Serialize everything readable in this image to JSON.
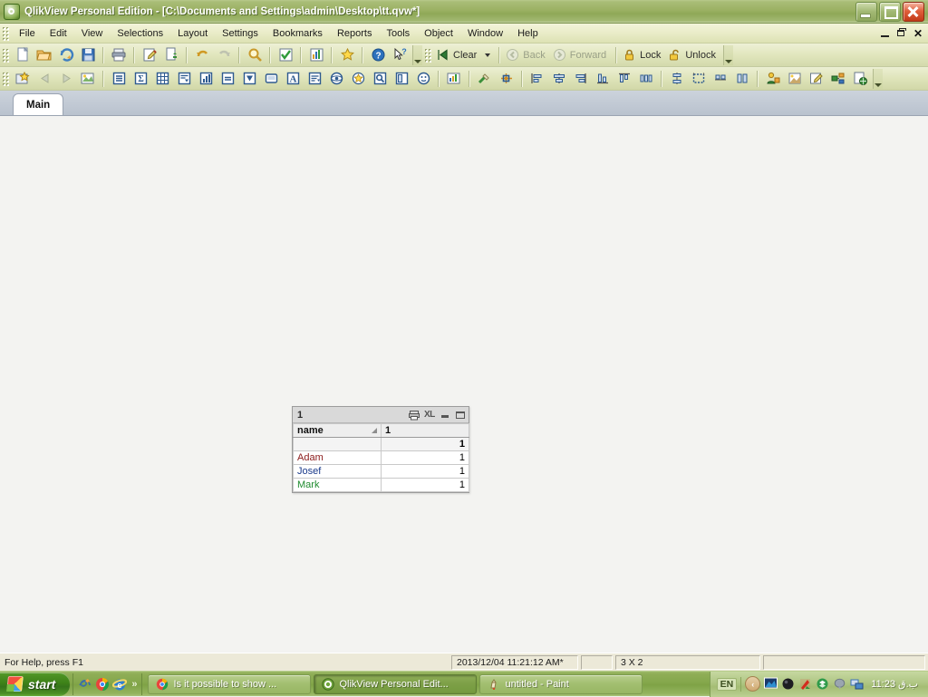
{
  "window": {
    "title": "QlikView Personal Edition - [C:\\Documents and Settings\\admin\\Desktop\\tt.qvw*]",
    "app_icon": "qlikview-icon",
    "controls": {
      "minimize": "Minimize",
      "restore": "Restore",
      "close": "Close"
    },
    "mdi_controls": {
      "minimize": "Minimize Document",
      "restore": "Restore Document",
      "close": "Close Document",
      "close_glyph": "✕"
    }
  },
  "menubar": {
    "items": [
      {
        "label": "File"
      },
      {
        "label": "Edit"
      },
      {
        "label": "View"
      },
      {
        "label": "Selections"
      },
      {
        "label": "Layout"
      },
      {
        "label": "Settings"
      },
      {
        "label": "Bookmarks"
      },
      {
        "label": "Reports"
      },
      {
        "label": "Tools"
      },
      {
        "label": "Object"
      },
      {
        "label": "Window"
      },
      {
        "label": "Help"
      }
    ]
  },
  "standard_toolbar": {
    "buttons": [
      {
        "name": "new-document-icon"
      },
      {
        "name": "open-document-icon"
      },
      {
        "name": "reload-icon"
      },
      {
        "name": "save-icon"
      },
      {
        "name": "print-icon"
      },
      {
        "name": "edit-script-icon"
      },
      {
        "name": "copy-image-icon"
      },
      {
        "name": "undo-icon"
      },
      {
        "name": "redo-icon"
      },
      {
        "name": "search-icon"
      },
      {
        "name": "current-selections-icon"
      },
      {
        "name": "chart-icon"
      },
      {
        "name": "add-bookmark-icon"
      },
      {
        "name": "help-icon"
      },
      {
        "name": "context-help-icon"
      }
    ]
  },
  "navigation_toolbar": {
    "clear_label": "Clear",
    "back_label": "Back",
    "forward_label": "Forward",
    "lock_label": "Lock",
    "unlock_label": "Unlock"
  },
  "design_toolbar": {
    "buttons": [
      {
        "name": "new-sheet-icon"
      },
      {
        "name": "previous-sheet-icon"
      },
      {
        "name": "next-sheet-icon"
      },
      {
        "name": "sheet-properties-icon"
      },
      {
        "name": "list-box-icon"
      },
      {
        "name": "statistics-box-icon"
      },
      {
        "name": "multi-box-icon"
      },
      {
        "name": "table-box-icon"
      },
      {
        "name": "chart-object-icon"
      },
      {
        "name": "input-box-icon"
      },
      {
        "name": "current-selections-box-icon"
      },
      {
        "name": "button-icon"
      },
      {
        "name": "text-object-icon"
      },
      {
        "name": "line-arrow-object-icon"
      },
      {
        "name": "slider-calendar-icon"
      },
      {
        "name": "bookmark-object-icon"
      },
      {
        "name": "search-object-icon"
      },
      {
        "name": "container-icon"
      },
      {
        "name": "custom-object-icon"
      },
      {
        "name": "system-table-icon"
      },
      {
        "name": "design-grid-icon"
      },
      {
        "name": "snap-to-grid-icon"
      },
      {
        "name": "align-left-icon"
      },
      {
        "name": "align-center-icon"
      },
      {
        "name": "align-right-icon"
      },
      {
        "name": "align-bottom-icon"
      },
      {
        "name": "align-top-icon"
      },
      {
        "name": "distribute-horizontal-icon"
      },
      {
        "name": "space-vertical-icon"
      },
      {
        "name": "size-equal-icon"
      },
      {
        "name": "space-across-icon"
      },
      {
        "name": "arrange-icon"
      },
      {
        "name": "promote-icon"
      },
      {
        "name": "layout-theme-icon"
      },
      {
        "name": "edit-module-icon"
      },
      {
        "name": "object-grouping-icon"
      },
      {
        "name": "publish-icon"
      }
    ]
  },
  "tabs": {
    "items": [
      {
        "label": "Main",
        "active": true
      }
    ]
  },
  "table_object": {
    "caption": "1",
    "caption_icons": [
      {
        "name": "send-to-printer-icon",
        "label": ""
      },
      {
        "name": "export-to-excel-icon",
        "label": "XL"
      },
      {
        "name": "minimize-object-icon",
        "label": ""
      },
      {
        "name": "maximize-object-icon",
        "label": ""
      }
    ],
    "columns": [
      {
        "label": "name",
        "sorted": true,
        "sort_direction": "ascending"
      },
      {
        "label": "1",
        "sorted": false
      }
    ],
    "total_row": {
      "name": "",
      "value": "1"
    },
    "rows": [
      {
        "name": "Adam",
        "value": "1",
        "color": "#8b1a1a"
      },
      {
        "name": "Josef",
        "value": "1",
        "color": "#1a3a8b"
      },
      {
        "name": "Mark",
        "value": "1",
        "color": "#1f8b2f"
      }
    ]
  },
  "statusbar": {
    "help_text": "For Help, press F1",
    "timestamp": "2013/12/04 11:21:12 AM*",
    "blank": "",
    "dimensions": "3 X 2",
    "rest": ""
  },
  "taskbar": {
    "start_label": "start",
    "quick_launch": [
      {
        "name": "messenger-icon"
      },
      {
        "name": "chrome-icon"
      },
      {
        "name": "internet-explorer-icon"
      }
    ],
    "quick_launch_overflow": "»",
    "tasks": [
      {
        "label": "Is it possible to show ...",
        "icon": "chrome-icon",
        "active": false
      },
      {
        "label": "QlikView Personal Edit...",
        "icon": "qlikview-icon",
        "active": true
      },
      {
        "label": "untitled - Paint",
        "icon": "paint-icon",
        "active": false
      }
    ],
    "tray": {
      "language": "EN",
      "chevron": "‹",
      "icons": [
        {
          "name": "display-properties-icon"
        },
        {
          "name": "black-sphere-icon"
        },
        {
          "name": "kaspersky-icon"
        },
        {
          "name": "dropbox-icon"
        },
        {
          "name": "balloon-icon"
        },
        {
          "name": "network-icon"
        }
      ],
      "clock": "11:23 ب.ق"
    }
  },
  "colors": {
    "titlebar_green": "#8fa857",
    "menubar_cream": "#e8ebc6",
    "taskbar_green": "#7fa346",
    "start_green": "#3d8118",
    "sheet_bg": "#f3f3f1",
    "table_caption_bg": "#d9d9d9",
    "close_red": "#c23a18"
  }
}
